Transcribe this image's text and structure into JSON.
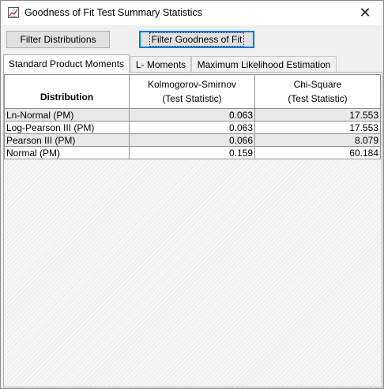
{
  "window": {
    "title": "Goodness of Fit Test Summary Statistics",
    "close_glyph": "✕"
  },
  "toolbar": {
    "filter_distributions_label": "Filter Distributions",
    "filter_goodness_label": "Filter Goodness of Fit"
  },
  "tabs": [
    {
      "label": "Standard Product Moments",
      "active": true
    },
    {
      "label": "L- Moments",
      "active": false
    },
    {
      "label": "Maximum Likelihood Estimation",
      "active": false
    }
  ],
  "table": {
    "headers": [
      {
        "line1": "Distribution",
        "line2": ""
      },
      {
        "line1": "Kolmogorov-Smirnov",
        "line2": "(Test Statistic)"
      },
      {
        "line1": "Chi-Square",
        "line2": "(Test Statistic)"
      }
    ],
    "rows": [
      [
        "Ln-Normal (PM)",
        "0.063",
        "17.553"
      ],
      [
        "Log-Pearson III (PM)",
        "0.063",
        "17.553"
      ],
      [
        "Pearson III (PM)",
        "0.066",
        "8.079"
      ],
      [
        "Normal (PM)",
        "0.159",
        "60.184"
      ]
    ]
  },
  "colors": {
    "focus_border": "#0078d7",
    "row_alt": "#e8e8e8"
  }
}
